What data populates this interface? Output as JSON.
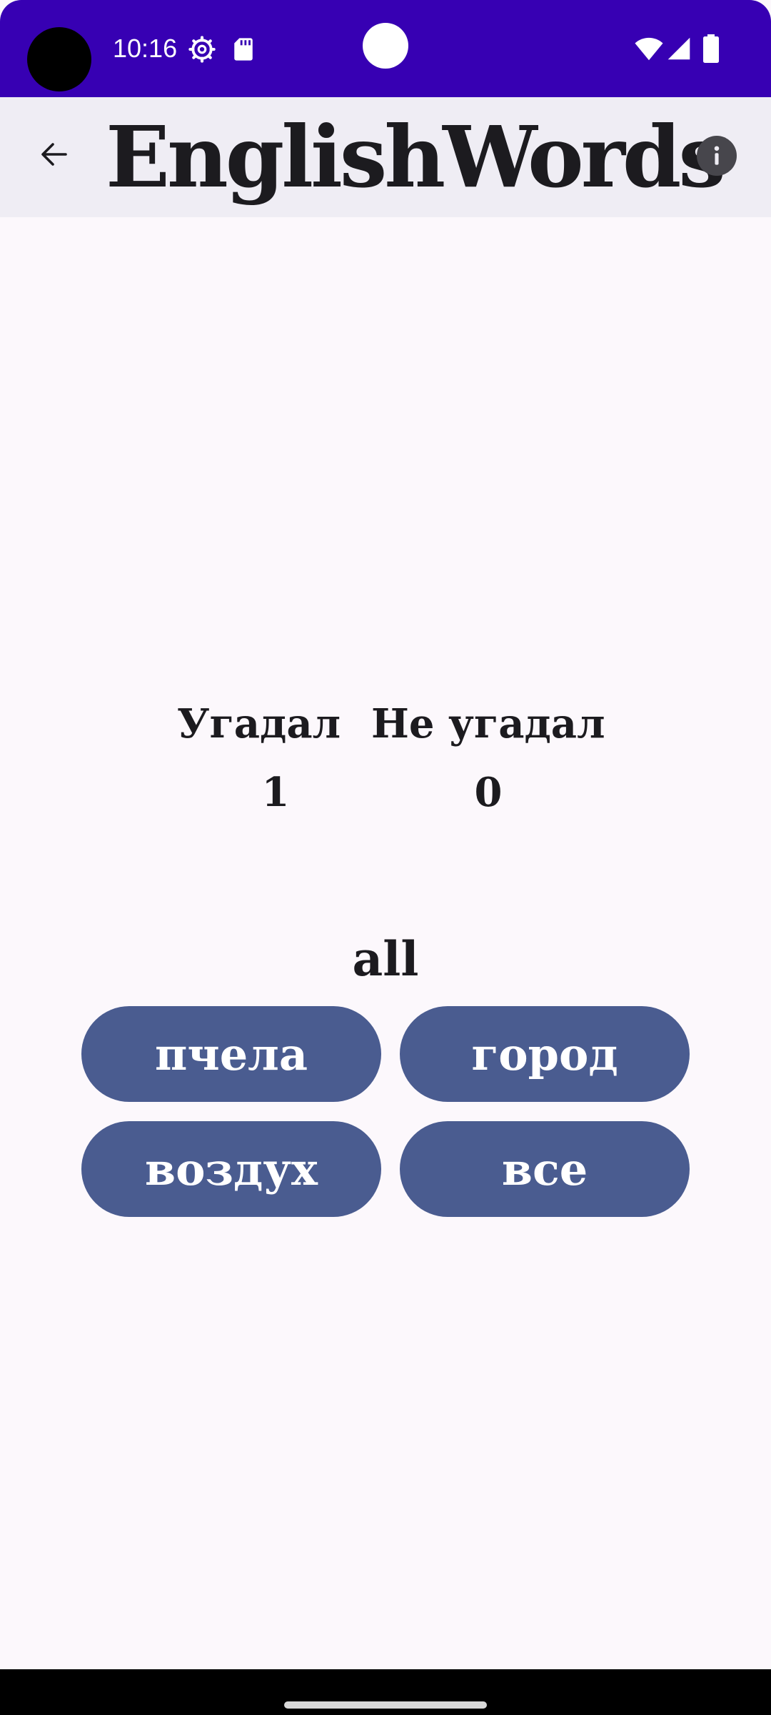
{
  "status_bar": {
    "time": "10:16",
    "icons": [
      "gear-icon",
      "sd-card-icon",
      "wifi-icon",
      "signal-icon",
      "battery-icon"
    ],
    "background_color": "#3700b3"
  },
  "app_bar": {
    "title": "EnglishWords",
    "back_icon": "arrow-back-icon",
    "info_icon": "info-icon",
    "background_color": "#efedf4"
  },
  "score": {
    "correct_label": "Угадал",
    "correct_value": "1",
    "wrong_label": "Не угадал",
    "wrong_value": "0"
  },
  "question": {
    "word": "all"
  },
  "answers": {
    "option_1": "пчела",
    "option_2": "город",
    "option_3": "воздух",
    "option_4": "все",
    "button_color": "#4a5c90"
  }
}
